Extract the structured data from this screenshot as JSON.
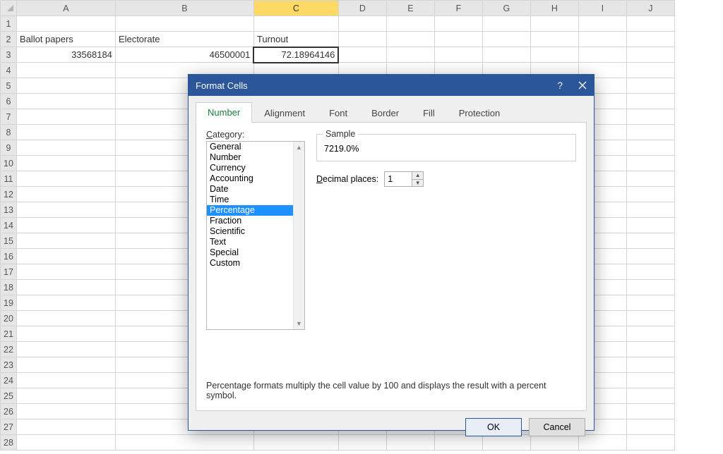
{
  "sheet": {
    "columns": [
      "A",
      "B",
      "C",
      "D",
      "E",
      "F",
      "G",
      "H",
      "I",
      "J"
    ],
    "rows_visible": 28,
    "selected_column": "C",
    "selected_cell": "C3",
    "cells": {
      "A2": "Ballot papers",
      "B2": "Electorate",
      "C2": "Turnout",
      "A3": "33568184",
      "B3": "46500001",
      "C3": "72.18964146"
    }
  },
  "dialog": {
    "title": "Format Cells",
    "help_icon": "?",
    "tabs": [
      "Number",
      "Alignment",
      "Font",
      "Border",
      "Fill",
      "Protection"
    ],
    "active_tab": "Number",
    "category_label": "Category:",
    "categories": [
      "General",
      "Number",
      "Currency",
      "Accounting",
      "Date",
      "Time",
      "Percentage",
      "Fraction",
      "Scientific",
      "Text",
      "Special",
      "Custom"
    ],
    "selected_category": "Percentage",
    "sample_label": "Sample",
    "sample_value": "7219.0%",
    "decimal_label": "Decimal places:",
    "decimal_value": "1",
    "description": "Percentage formats multiply the cell value by 100 and displays the result with a percent symbol.",
    "ok_label": "OK",
    "cancel_label": "Cancel"
  }
}
